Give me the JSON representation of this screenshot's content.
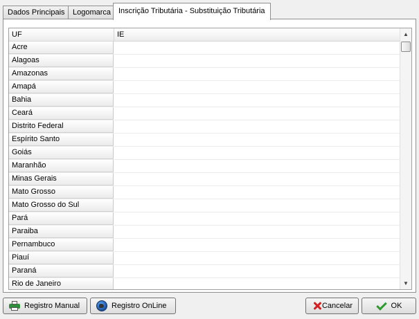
{
  "tabs": [
    {
      "label": "Dados Principais"
    },
    {
      "label": "Logomarca"
    },
    {
      "label": "Inscrição Tributária - Substituição Tributária"
    }
  ],
  "grid": {
    "columns": {
      "uf": "UF",
      "ie": "IE"
    },
    "rows": [
      {
        "uf": "Acre",
        "ie": ""
      },
      {
        "uf": "Alagoas",
        "ie": ""
      },
      {
        "uf": "Amazonas",
        "ie": ""
      },
      {
        "uf": "Amapá",
        "ie": ""
      },
      {
        "uf": "Bahia",
        "ie": ""
      },
      {
        "uf": "Ceará",
        "ie": ""
      },
      {
        "uf": "Distrito Federal",
        "ie": ""
      },
      {
        "uf": "Espírito Santo",
        "ie": ""
      },
      {
        "uf": "Goiás",
        "ie": ""
      },
      {
        "uf": "Maranhão",
        "ie": ""
      },
      {
        "uf": "Minas Gerais",
        "ie": ""
      },
      {
        "uf": "Mato Grosso",
        "ie": ""
      },
      {
        "uf": "Mato Grosso do Sul",
        "ie": ""
      },
      {
        "uf": "Pará",
        "ie": ""
      },
      {
        "uf": "Paraiba",
        "ie": ""
      },
      {
        "uf": "Pernambuco",
        "ie": ""
      },
      {
        "uf": "Piauí",
        "ie": ""
      },
      {
        "uf": "Paraná",
        "ie": ""
      },
      {
        "uf": "Rio de Janeiro",
        "ie": ""
      }
    ]
  },
  "scroll_icons": {
    "up": "scroll-up-arrow",
    "down": "scroll-down-arrow"
  },
  "buttons": {
    "registro_manual": {
      "label": "Registro Manual",
      "icon": "printer-icon"
    },
    "registro_online": {
      "label": "Registro OnLine",
      "icon": "globe-icon"
    },
    "cancelar": {
      "label": "Cancelar",
      "icon": "cancel-icon"
    },
    "ok": {
      "label": "OK",
      "icon": "check-icon"
    }
  }
}
